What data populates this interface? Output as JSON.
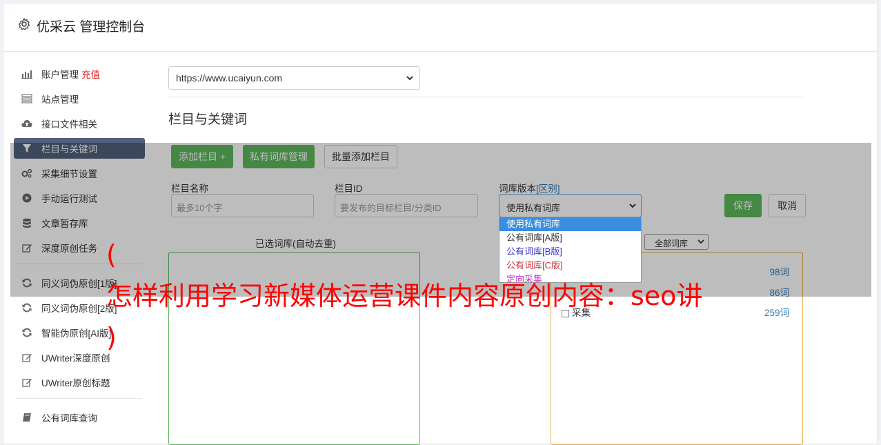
{
  "header": {
    "title": "优采云 管理控制台"
  },
  "sidebar": {
    "items": [
      {
        "label": "账户管理",
        "extra": "充值",
        "icon": "bar-chart-icon"
      },
      {
        "label": "站点管理",
        "icon": "server-icon"
      },
      {
        "label": "接口文件相关",
        "icon": "cloud-upload-icon"
      },
      {
        "label": "栏目与关键词",
        "icon": "filter-icon"
      },
      {
        "label": "采集细节设置",
        "icon": "gears-icon"
      },
      {
        "label": "手动运行测试",
        "icon": "play-icon"
      },
      {
        "label": "文章暂存库",
        "icon": "database-icon"
      },
      {
        "label": "深度原创任务",
        "icon": "edit-icon"
      },
      {
        "label": "同义词伪原创[1版]",
        "icon": "refresh-icon"
      },
      {
        "label": "同义词伪原创[2版]",
        "icon": "refresh-icon"
      },
      {
        "label": "智能伪原创[AI版]",
        "icon": "refresh-icon"
      },
      {
        "label": "UWriter深度原创",
        "icon": "edit-icon"
      },
      {
        "label": "UWriter原创标题",
        "icon": "edit-icon"
      },
      {
        "label": "公有词库查询",
        "icon": "book-icon"
      }
    ]
  },
  "main": {
    "site_select": "https://www.ucaiyun.com",
    "section_title": "栏目与关键词",
    "buttons": {
      "add_column": "添加栏目 +",
      "private_lib": "私有词库管理",
      "batch_add": "批量添加栏目",
      "save": "保存",
      "cancel": "取消"
    },
    "form": {
      "name_label": "栏目名称",
      "name_placeholder": "最多10个字",
      "id_label": "栏目ID",
      "id_placeholder": "要发布的目标栏目/分类ID",
      "lib_label": "词库版本",
      "lib_label_link": "[区别]",
      "lib_value": "使用私有词库"
    },
    "dropdown_options": [
      {
        "label": "使用私有词库",
        "color": "#ffffff"
      },
      {
        "label": "公有词库[A版]",
        "color": "#333333"
      },
      {
        "label": "公有词库[B版]",
        "color": "#3333cc"
      },
      {
        "label": "公有词库[C版]",
        "color": "#cc3333"
      },
      {
        "label": "定向采集",
        "color": "#cc33cc"
      }
    ],
    "selected_title": "已选词库(自动去重)",
    "filter_select": "全部词库",
    "library_rows": [
      {
        "name": "",
        "count": "98词"
      },
      {
        "name": "",
        "count": "86词"
      },
      {
        "name": "采集",
        "count": "259词"
      }
    ]
  },
  "watermark": {
    "open": "(",
    "text": "怎样利用学习新媒体运营课件内容原创内容：seo讲",
    "close": ")"
  },
  "colors": {
    "accent_green": "#5cb85c",
    "active_nav": "#50617b",
    "watermark": "#ff0000"
  }
}
